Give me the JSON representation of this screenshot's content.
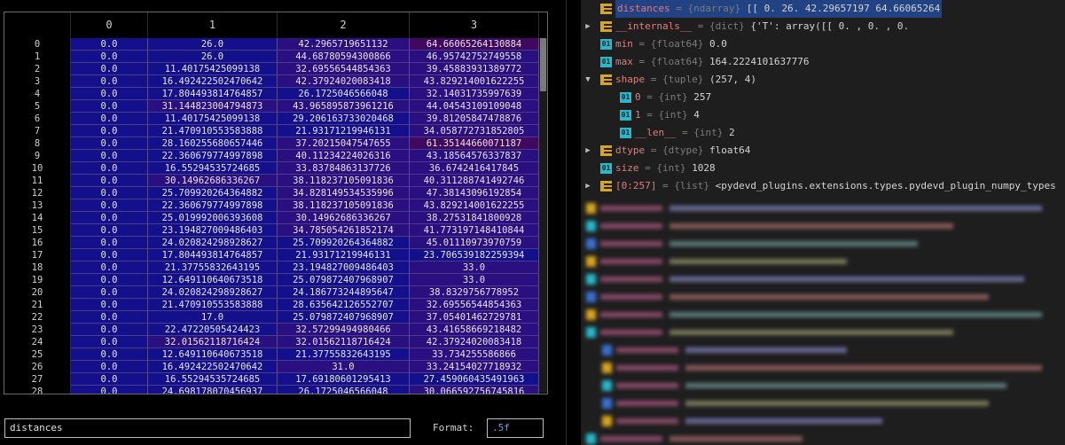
{
  "viewer": {
    "columns": [
      "0",
      "1",
      "2",
      "3"
    ],
    "rows": [
      [
        "0",
        "0.0",
        "26.0",
        "42.2965719651132",
        "64.66065264130884"
      ],
      [
        "1",
        "0.0",
        "26.0",
        "44.68780594300866",
        "46.95742752749558"
      ],
      [
        "2",
        "0.0",
        "11.40175425099138",
        "32.69556544854363",
        "39.45883931389772"
      ],
      [
        "3",
        "0.0",
        "16.492422502470642",
        "42.37924020083418",
        "43.829214001622255"
      ],
      [
        "4",
        "0.0",
        "17.804493814764857",
        "26.1725046566048",
        "32.14031735997639"
      ],
      [
        "5",
        "0.0",
        "31.144823004794873",
        "43.965895873961216",
        "44.04543109109048"
      ],
      [
        "6",
        "0.0",
        "11.40175425099138",
        "29.206163733020468",
        "39.81205847478876"
      ],
      [
        "7",
        "0.0",
        "21.470910553583888",
        "21.93171219946131",
        "34.058772731852805"
      ],
      [
        "8",
        "0.0",
        "28.160255680657446",
        "37.20215047547655",
        "61.35144660071187"
      ],
      [
        "9",
        "0.0",
        "22.360679774997898",
        "40.11234224026316",
        "43.18564576337837"
      ],
      [
        "10",
        "0.0",
        "16.55294535724685",
        "33.83784863137726",
        "36.6742416417845"
      ],
      [
        "11",
        "0.0",
        "30.14962686336267",
        "38.118237105091836",
        "40.311288741492746"
      ],
      [
        "12",
        "0.0",
        "25.709920264364882",
        "34.828149534535996",
        "47.38143096192854"
      ],
      [
        "13",
        "0.0",
        "22.360679774997898",
        "38.118237105091836",
        "43.829214001622255"
      ],
      [
        "14",
        "0.0",
        "25.019992006393608",
        "30.14962686336267",
        "38.27531841800928"
      ],
      [
        "15",
        "0.0",
        "23.194827009486403",
        "34.785054261852174",
        "41.773197148410844"
      ],
      [
        "16",
        "0.0",
        "24.020824298928627",
        "25.709920264364882",
        "45.01110973970759"
      ],
      [
        "17",
        "0.0",
        "17.804493814764857",
        "21.93171219946131",
        "23.706539182259394"
      ],
      [
        "18",
        "0.0",
        "21.37755832643195",
        "23.194827009486403",
        "33.0"
      ],
      [
        "19",
        "0.0",
        "12.649110640673518",
        "25.079872407968907",
        "33.0"
      ],
      [
        "20",
        "0.0",
        "24.020824298928627",
        "24.186773244895647",
        "38.8329756778952"
      ],
      [
        "21",
        "0.0",
        "21.470910553583888",
        "28.635642126552707",
        "32.69556544854363"
      ],
      [
        "22",
        "0.0",
        "17.0",
        "25.079872407968907",
        "37.05401462729781"
      ],
      [
        "23",
        "0.0",
        "22.47220505424423",
        "32.57299494980466",
        "43.41658669218482"
      ],
      [
        "24",
        "0.0",
        "32.01562118716424",
        "32.01562118716424",
        "42.37924020083418"
      ],
      [
        "25",
        "0.0",
        "12.649110640673518",
        "21.37755832643195",
        "33.734255586866"
      ],
      [
        "26",
        "0.0",
        "16.492422502470642",
        "31.0",
        "33.24154027718932"
      ],
      [
        "27",
        "0.0",
        "16.55294535724685",
        "17.69180601295413",
        "27.459060435491963"
      ],
      [
        "28",
        "0.0",
        "24.698178070456937",
        "26.1725046566048",
        "30.066592756745816"
      ]
    ],
    "cell_colors": {
      "low": "#14108c",
      "mid": "#2a0f80",
      "high": "#40085e"
    },
    "name_value": "distances",
    "format_label": "Format:",
    "format_value": ".5f"
  },
  "variables": {
    "rows": [
      {
        "arrow": "",
        "icon": "array-icon",
        "name": "distances",
        "type": " = {ndarray} ",
        "value": "[[  0.          26.          42.29657197  64.66065264",
        "selected": true
      },
      {
        "arrow": "▶",
        "icon": "array-icon",
        "name": "__internals__",
        "type": " = {dict} ",
        "value": "{'T': array([[  0.          ,   0.          ,   0.",
        "selected": false
      },
      {
        "arrow": "",
        "icon": "number-icon",
        "name": "min",
        "type": " = {float64} ",
        "value": "0.0",
        "selected": false
      },
      {
        "arrow": "",
        "icon": "number-icon",
        "name": "max",
        "type": " = {float64} ",
        "value": "164.2224101637776",
        "selected": false
      },
      {
        "arrow": "▼",
        "icon": "array-icon",
        "name": "shape",
        "type": " = {tuple} ",
        "value": "(257, 4)",
        "selected": false
      },
      {
        "arrow": "",
        "icon": "number-icon",
        "name": "0",
        "type": " = {int} ",
        "value": "257",
        "selected": false,
        "indent": true
      },
      {
        "arrow": "",
        "icon": "number-icon",
        "name": "1",
        "type": " = {int} ",
        "value": "4",
        "selected": false,
        "indent": true
      },
      {
        "arrow": "",
        "icon": "number-icon",
        "name": "__len__",
        "type": " = {int} ",
        "value": "2",
        "selected": false,
        "indent": true
      },
      {
        "arrow": "▶",
        "icon": "array-icon",
        "name": "dtype",
        "type": " = {dtype} ",
        "value": "float64",
        "selected": false
      },
      {
        "arrow": "",
        "icon": "number-icon",
        "name": "size",
        "type": " = {int} ",
        "value": "1028",
        "selected": false
      },
      {
        "arrow": "▶",
        "icon": "array-icon",
        "name": "[0:257]",
        "type": " = {list} ",
        "value": "<pydevd_plugins.extensions.types.pydevd_plugin_numpy_types",
        "selected": false
      }
    ]
  }
}
